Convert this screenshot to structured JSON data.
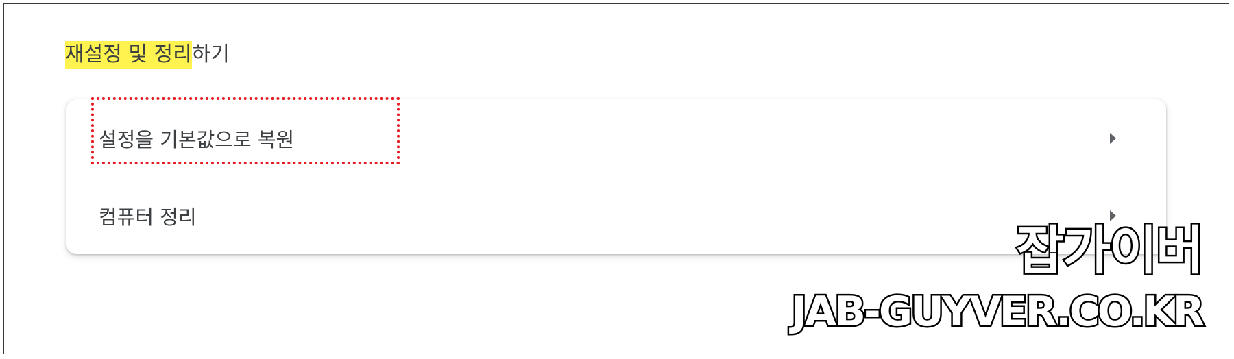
{
  "section": {
    "title_highlighted": "재설정 및 정리",
    "title_rest": "하기",
    "highlight_color": "#fff34f"
  },
  "settings_list": {
    "items": [
      {
        "label": "설정을 기본값으로 복원",
        "icon": "arrow-right-icon"
      },
      {
        "label": "컴퓨터 정리",
        "icon": "arrow-right-icon"
      }
    ]
  },
  "annotation": {
    "box_color": "#e51c23",
    "style": "dotted"
  },
  "watermark": {
    "name": "잡가이버",
    "url": "JAB-GUYVER.CO.KR"
  }
}
